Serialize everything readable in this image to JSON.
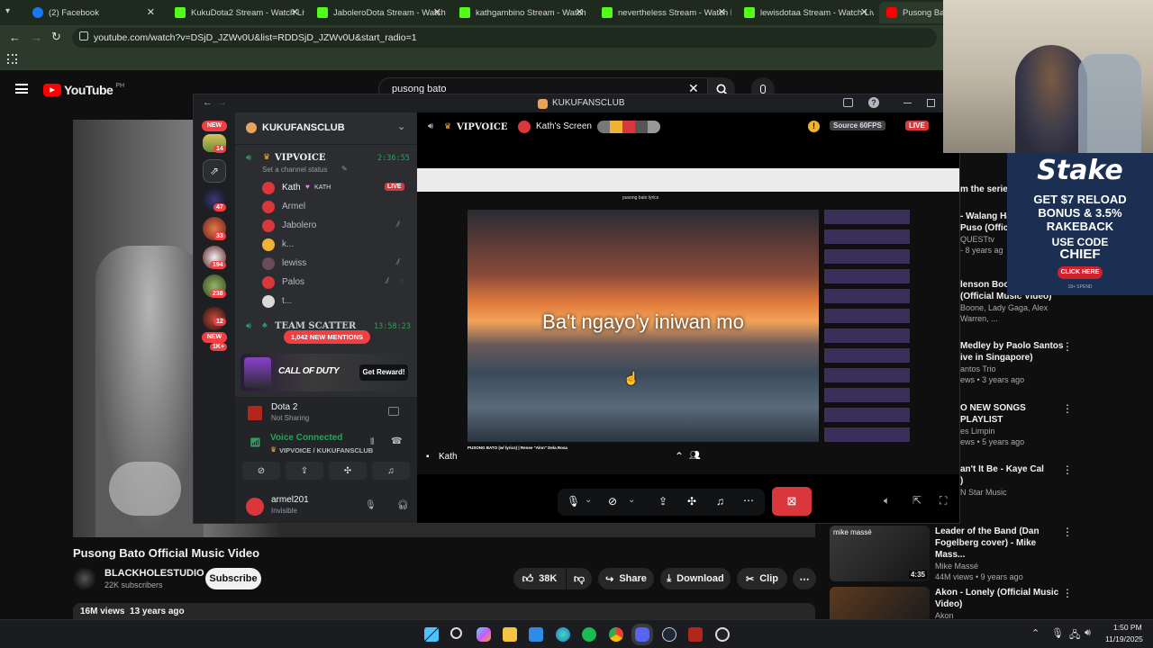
{
  "browser": {
    "tabs": [
      {
        "title": "(2) Facebook",
        "icon": "facebook-icon",
        "color": "#1877f2"
      },
      {
        "title": "KukuDota2 Stream - Watch Liv",
        "icon": "kick-icon",
        "color": "#53fc18"
      },
      {
        "title": "JaboleroDota Stream - Watch L",
        "icon": "kick-icon",
        "color": "#53fc18"
      },
      {
        "title": "kathgambino Stream - Watch L",
        "icon": "kick-icon",
        "color": "#53fc18"
      },
      {
        "title": "nevertheless Stream - Watch Li",
        "icon": "kick-icon",
        "color": "#53fc18"
      },
      {
        "title": "lewisdotaa Stream - Watch Liv",
        "icon": "kick-icon",
        "color": "#53fc18"
      },
      {
        "title": "Pusong Bato O",
        "icon": "youtube-icon",
        "color": "#ff0000"
      }
    ],
    "url": "youtube.com/watch?v=DSjD_JZWv0U&list=RDDSjD_JZWv0U&start_radio=1"
  },
  "youtube": {
    "logo_text": "YouTube",
    "logo_region": "PH",
    "search_value": "pusong bato",
    "video_title": "Pusong Bato Official Music Video",
    "channel_name": "BLACKHOLESTUDIO",
    "subscribers": "22K subscribers",
    "subscribe_label": "Subscribe",
    "likes": "38K",
    "share_label": "Share",
    "download_label": "Download",
    "clip_label": "Clip",
    "views_age": "16M views  13 years ago",
    "right_header": "m the series",
    "recommendations": [
      {
        "title": "- Walang Ha\nPuso (Official Music Vide",
        "meta1": "QUESTtv",
        "meta2": "- 8 years ag"
      },
      {
        "title": "lenson Boone\n(Official Music Video)",
        "meta1": "Boone, Lady Gaga, Alex Warren, ...",
        "meta2": ""
      },
      {
        "title": "Medley by Paolo Santos\nive in Singapore)",
        "meta1": "antos Trio",
        "meta2": "ews • 3 years ago"
      },
      {
        "title": "O NEW SONGS PLAYLIST",
        "meta1": "es Limpin",
        "meta2": "ews • 5 years ago"
      },
      {
        "title": "an't It Be - Kaye Cal\n)",
        "meta1": "N Star Music",
        "meta2": "ews • 8 years ago"
      },
      {
        "title": "Leader of the Band (Dan\nFogelberg cover) - Mike Mass...",
        "meta1": "Mike Massé",
        "meta2": "44M views • 9 years ago",
        "duration": "4:35",
        "thumb_caption": "mike massé"
      },
      {
        "title": "Akon - Lonely (Official Music\nVideo)",
        "meta1": "Akon",
        "meta2": ""
      }
    ]
  },
  "discord": {
    "window_title": "KUKUFANSCLUB",
    "server_name": "KUKUFANSCLUB",
    "new_badge": "NEW",
    "new_badge_bottom": "NEW",
    "server_badges": [
      "14",
      "47",
      "33",
      "194",
      "238",
      "12",
      "1K+"
    ],
    "voice_channel": "VIPVOICE",
    "voice_timer": "2:36:55",
    "channel_status": "Set a channel status",
    "members": [
      {
        "name": "Kath",
        "tag": "KATH",
        "live": "LIVE"
      },
      {
        "name": "Armel"
      },
      {
        "name": "Jabolero"
      },
      {
        "name": "k..."
      },
      {
        "name": "lewiss"
      },
      {
        "name": "Palos"
      },
      {
        "name": "t..."
      }
    ],
    "team_channel": "TEAM SCATTER",
    "team_timer": "13:58:23",
    "mentions_label": "1,042 NEW MENTIONS",
    "promo_game": "CALL OF DUTY",
    "promo_button": "Get Reward!",
    "activity_game": "Dota 2",
    "activity_status": "Not Sharing",
    "voice_connected": "Voice Connected",
    "voice_path": "VIPVOICE / KUKUFANSCLUB",
    "user_name": "armel201",
    "user_status": "Invisible",
    "stream_header_channel": "VIPVOICE",
    "stream_header_screen": "Kath's Screen",
    "source_label": "Source 60FPS",
    "live_label": "LIVE",
    "stream_user": "Kath",
    "lyric": "Ba't ngayo'y iniwan mo",
    "inner_title": "PUSONG BATO (w/ lyrics) | Renee \"Alon\" Dela Rosa",
    "inner_search": "pusong bato lyrics"
  },
  "overlay": {
    "ad_brand": "Stake",
    "ad_line1": "GET $7 RELOAD",
    "ad_line2": "BONUS & 3.5%",
    "ad_line3": "RAKEBACK",
    "ad_line4": "USE CODE",
    "ad_code": "CHIEF",
    "ad_button": "CLICK HERE",
    "ad_foot": "18+ SPEND"
  },
  "taskbar": {
    "time": "1:50 PM",
    "date": "11/19/2025"
  },
  "colors": {
    "youtube_red": "#ff0000",
    "discord_blurple": "#5865f2",
    "discord_green": "#23a55a",
    "live_red": "#da373c",
    "stake_blue": "#1b2f53"
  }
}
